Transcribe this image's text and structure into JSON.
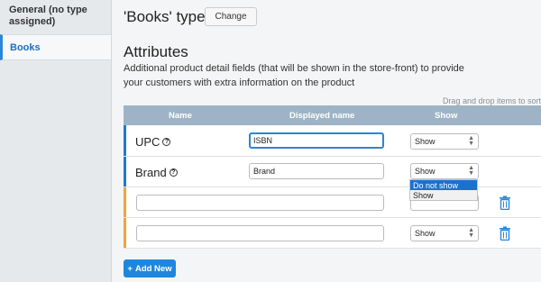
{
  "sidebar": {
    "items": [
      {
        "label": "General (no type assigned)"
      },
      {
        "label": "Books"
      }
    ]
  },
  "header": {
    "type_title": "'Books' type",
    "change_label": "Change"
  },
  "attributes": {
    "title": "Attributes",
    "description": "Additional product detail fields (that will be shown in the store-front) to provide your customers with extra information on the product",
    "hint": "Drag and drop items to sort",
    "columns": {
      "name": "Name",
      "displayed": "Displayed name",
      "show": "Show"
    },
    "rows": [
      {
        "name": "UPC",
        "displayed_value": "ISBN",
        "show": "Show"
      },
      {
        "name": "Brand",
        "displayed_value": "Brand",
        "show": "Show"
      },
      {
        "name": "",
        "displayed_value": "",
        "show": ""
      },
      {
        "name": "",
        "displayed_value": "",
        "show": "Show"
      }
    ],
    "dropdown_options": [
      "Do not show",
      "Show"
    ],
    "add_label": "Add New"
  },
  "icons": {
    "info": "info-icon",
    "trash": "trash-icon",
    "plus": "plus-icon",
    "select_arrows": "select-arrows-icon"
  },
  "colors": {
    "accent": "#2a86d8",
    "header": "#9eb4c6",
    "orange": "#f0a33a",
    "add_button": "#1f86de"
  }
}
